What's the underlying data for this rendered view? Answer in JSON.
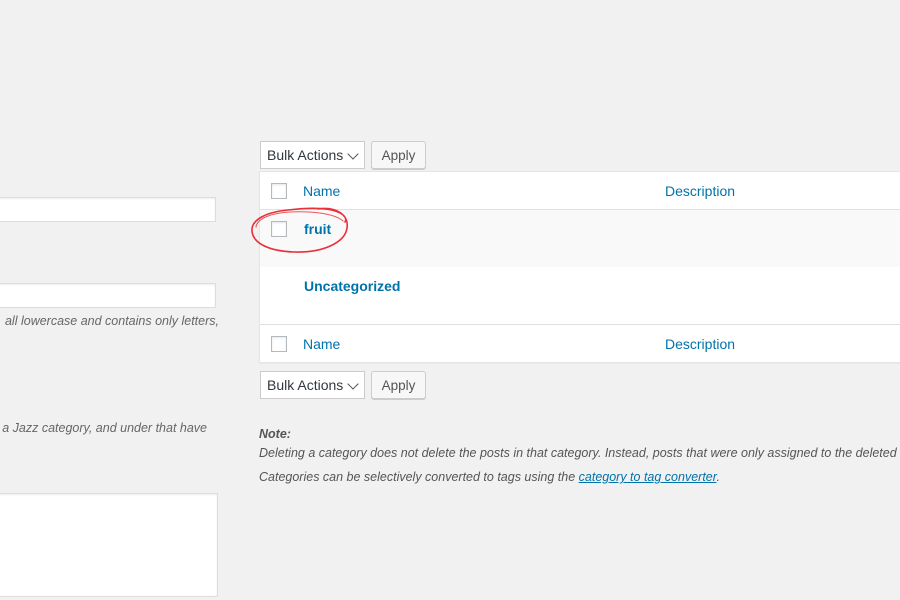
{
  "left_form": {
    "slug_hint": "all lowercase and contains only letters,",
    "parent_hint": "a Jazz category, and under that have"
  },
  "bulk_actions": {
    "top": {
      "select_label": "Bulk Actions",
      "apply_label": "Apply"
    },
    "bottom": {
      "select_label": "Bulk Actions",
      "apply_label": "Apply"
    }
  },
  "table": {
    "columns": {
      "name": "Name",
      "description": "Description"
    },
    "rows": [
      {
        "name": "fruit",
        "description": ""
      },
      {
        "name": "Uncategorized",
        "description": ""
      }
    ]
  },
  "note": {
    "title": "Note:",
    "line1": "Deleting a category does not delete the posts in that category. Instead, posts that were only assigned to the deleted",
    "line2_prefix": "Categories can be selectively converted to tags using the ",
    "line2_link": "category to tag converter",
    "line2_suffix": "."
  },
  "annotation": {
    "color": "#e8303a",
    "shape": "hand-drawn circle around fruit row checkbox and title"
  }
}
